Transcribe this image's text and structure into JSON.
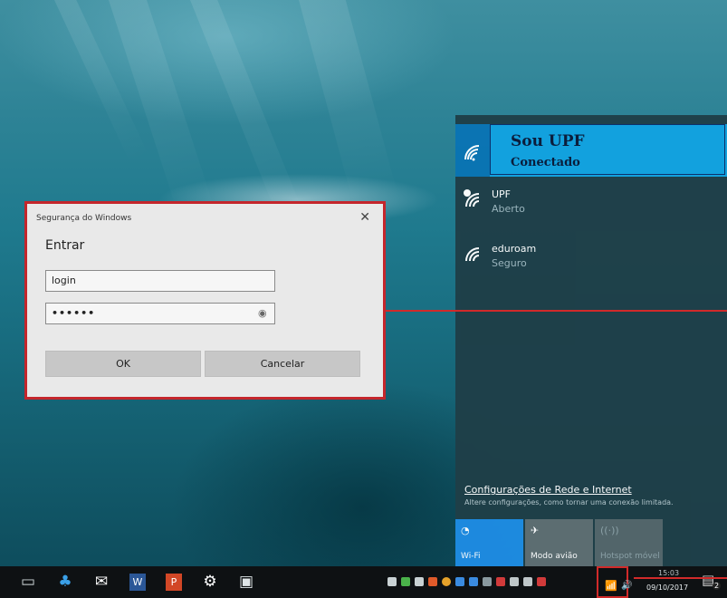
{
  "dialog": {
    "title": "Segurança do Windows",
    "close": "✕",
    "heading": "Entrar",
    "login_value": "login",
    "password_value": "••••••",
    "ok_label": "OK",
    "cancel_label": "Cancelar"
  },
  "network": {
    "connected": {
      "ssid": "Sou UPF",
      "status": "Conectado"
    },
    "available": [
      {
        "ssid": "UPF",
        "status": "Aberto",
        "icon": "wifi-open-icon"
      },
      {
        "ssid": "eduroam",
        "status": "Seguro",
        "icon": "wifi-secure-icon"
      }
    ],
    "settings_link": "Configurações de Rede e Internet",
    "settings_sub": "Altere configurações, como tornar uma conexão limitada.",
    "quick_actions": [
      {
        "label": "Wi-Fi",
        "icon": "wifi-icon"
      },
      {
        "label": "Modo avião",
        "icon": "airplane-icon"
      },
      {
        "label": "Hotspot móvel",
        "icon": "hotspot-icon"
      }
    ]
  },
  "taskbar": {
    "clock_time": "15:03",
    "clock_date": "09/10/2017",
    "notification_count": "2"
  },
  "colors": {
    "accent": "#12a3e1",
    "highlight_red": "#c4262c",
    "panel_bg": "#1f3f48"
  }
}
